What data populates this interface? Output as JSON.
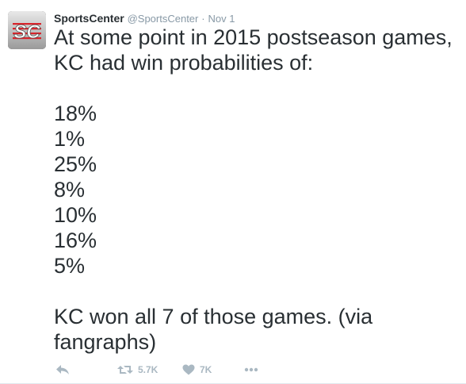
{
  "author": {
    "name": "SportsCenter",
    "handle": "@SportsCenter",
    "separator": "·",
    "time": "Nov 1",
    "avatar_text": "SC"
  },
  "tweet": {
    "text": "At some point in 2015 postseason games,\nKC had win probabilities of:\n\n18%\n1%\n25%\n8%\n10%\n16%\n5%\n\nKC won all 7 of those games. (via\nfangraphs)"
  },
  "actions": {
    "retweet_count": "5.7K",
    "like_count": "7K"
  },
  "icons": {
    "reply": "reply-icon",
    "retweet": "retweet-icon",
    "like": "heart-icon",
    "more": "more-icon"
  },
  "colors": {
    "text": "#292f33",
    "muted": "#8899a6",
    "action": "#aab8c2",
    "avatar_red": "#d8232a"
  }
}
